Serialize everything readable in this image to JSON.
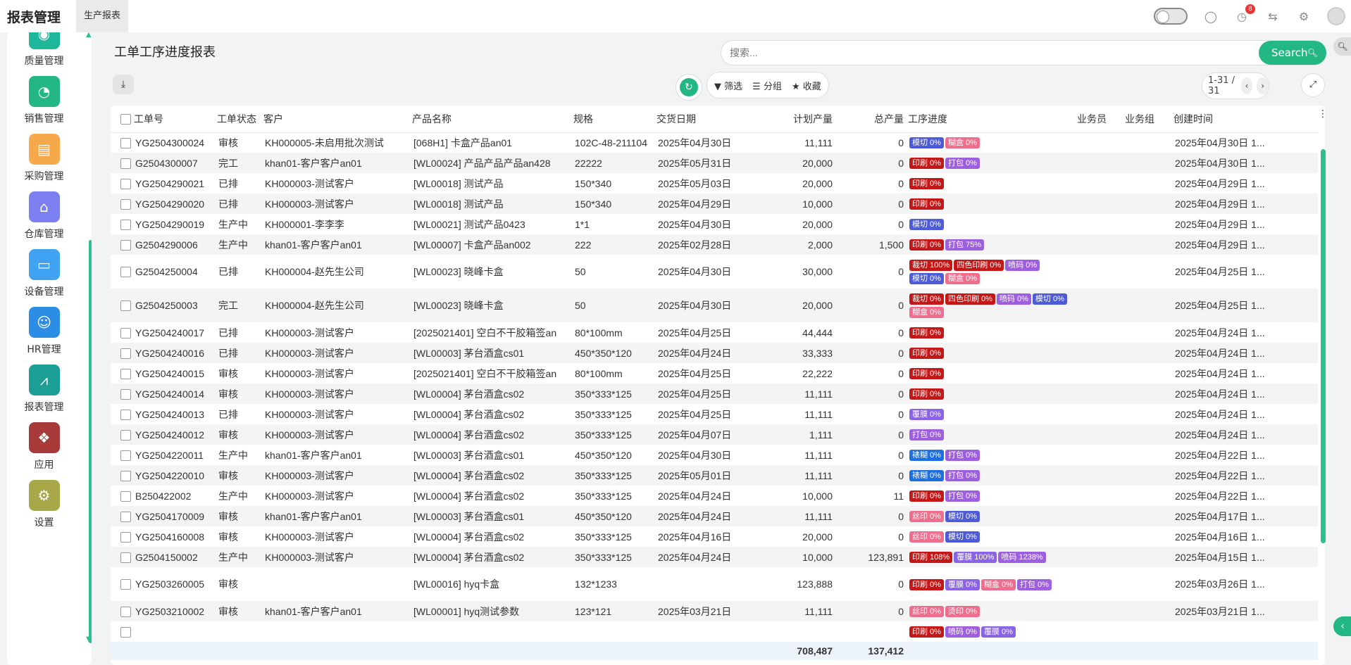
{
  "app_title": "报表管理",
  "top_tab": "生产报表",
  "notification_count": "8",
  "sidebar": {
    "items": [
      {
        "label": "质量管理",
        "icon": "quality-icon",
        "color": "#1fb79a"
      },
      {
        "label": "销售管理",
        "icon": "pie-chart-icon",
        "color": "#23b883"
      },
      {
        "label": "采购管理",
        "icon": "purchase-icon",
        "color": "#f6a94a"
      },
      {
        "label": "仓库管理",
        "icon": "warehouse-icon",
        "color": "#7b7ff0"
      },
      {
        "label": "设备管理",
        "icon": "device-icon",
        "color": "#3fa3f2"
      },
      {
        "label": "HR管理",
        "icon": "hr-icon",
        "color": "#2b8de3"
      },
      {
        "label": "报表管理",
        "icon": "report-icon",
        "color": "#1a9e96"
      },
      {
        "label": "应用",
        "icon": "apps-icon",
        "color": "#a83a3a"
      },
      {
        "label": "设置",
        "icon": "settings-icon",
        "color": "#a8a848"
      }
    ]
  },
  "page": {
    "title": "工单工序进度报表",
    "search_placeholder": "搜索...",
    "search_label": "Search",
    "filter_label": "筛选",
    "group_label": "分组",
    "favorite_label": "收藏",
    "pager": "1-31 / 31"
  },
  "table": {
    "headers": [
      "工单号",
      "工单状态",
      "客户",
      "产品名称",
      "规格",
      "交货日期",
      "计划产量",
      "总产量",
      "工序进度",
      "业务员",
      "业务组",
      "创建时间"
    ],
    "rows": [
      {
        "no": "YG2504300024",
        "status": "审核",
        "customer": "KH000005-未启用批次测试",
        "product": "[068H1] 卡盒产品an01",
        "spec": "102C-48-211104",
        "date": "2025年04月30日",
        "plan": "11,111",
        "total": "0",
        "progress": [
          {
            "t": "模切 0%",
            "c": "#4e5bd6"
          },
          {
            "t": "糊盒 0%",
            "c": "#ef6e8e"
          }
        ],
        "created": "2025年04月30日 1..."
      },
      {
        "no": "G2504300007",
        "status": "完工",
        "customer": "khan01-客户客户an01",
        "product": "[WL00024] 产品产品产品an428",
        "spec": "22222",
        "date": "2025年05月31日",
        "plan": "20,000",
        "total": "0",
        "progress": [
          {
            "t": "印刷 0%",
            "c": "#c41818"
          },
          {
            "t": "打包 0%",
            "c": "#9d5fe0"
          }
        ],
        "created": "2025年04月30日 1..."
      },
      {
        "no": "YG2504290021",
        "status": "已排",
        "customer": "KH000003-测试客户",
        "product": "[WL00018] 测试产品",
        "spec": "150*340",
        "date": "2025年05月03日",
        "plan": "20,000",
        "total": "0",
        "progress": [
          {
            "t": "印刷 0%",
            "c": "#c41818"
          }
        ],
        "created": "2025年04月29日 1..."
      },
      {
        "no": "YG2504290020",
        "status": "已排",
        "customer": "KH000003-测试客户",
        "product": "[WL00018] 测试产品",
        "spec": "150*340",
        "date": "2025年04月29日",
        "plan": "10,000",
        "total": "0",
        "progress": [
          {
            "t": "印刷 0%",
            "c": "#c41818"
          }
        ],
        "created": "2025年04月29日 1..."
      },
      {
        "no": "YG2504290019",
        "status": "生产中",
        "customer": "KH000001-李李李",
        "product": "[WL00021] 测试产品0423",
        "spec": "1*1",
        "date": "2025年04月30日",
        "plan": "20,000",
        "total": "0",
        "progress": [
          {
            "t": "模切 0%",
            "c": "#4e5bd6"
          }
        ],
        "created": "2025年04月29日 1..."
      },
      {
        "no": "G2504290006",
        "status": "生产中",
        "customer": "khan01-客户客户an01",
        "product": "[WL00007] 卡盒产品an002",
        "spec": "222",
        "date": "2025年02月28日",
        "plan": "2,000",
        "total": "1,500",
        "progress": [
          {
            "t": "印刷 0%",
            "c": "#c41818"
          },
          {
            "t": "打包 75%",
            "c": "#9d5fe0"
          }
        ],
        "created": "2025年04月29日 1..."
      },
      {
        "no": "G2504250004",
        "status": "已排",
        "customer": "KH000004-赵先生公司",
        "product": "[WL00023] 晓峰卡盒",
        "spec": "50",
        "date": "2025年04月30日",
        "plan": "30,000",
        "total": "0",
        "progress": [
          {
            "t": "裁切 100%",
            "c": "#c41818"
          },
          {
            "t": "四色印刷 0%",
            "c": "#c41818"
          },
          {
            "t": "喷码 0%",
            "c": "#9d5fe0"
          },
          {
            "t": "模切 0%",
            "c": "#4e5bd6"
          },
          {
            "t": "糊盒 0%",
            "c": "#ef6e8e"
          }
        ],
        "created": "2025年04月25日 1..."
      },
      {
        "no": "G2504250003",
        "status": "完工",
        "customer": "KH000004-赵先生公司",
        "product": "[WL00023] 晓峰卡盒",
        "spec": "50",
        "date": "2025年04月30日",
        "plan": "20,000",
        "total": "0",
        "progress": [
          {
            "t": "裁切 0%",
            "c": "#c41818"
          },
          {
            "t": "四色印刷 0%",
            "c": "#c41818"
          },
          {
            "t": "喷码 0%",
            "c": "#9d5fe0"
          },
          {
            "t": "模切 0%",
            "c": "#4e5bd6"
          },
          {
            "t": "糊盒 0%",
            "c": "#ef6e8e"
          }
        ],
        "created": "2025年04月25日 1..."
      },
      {
        "no": "YG2504240017",
        "status": "已排",
        "customer": "KH000003-测试客户",
        "product": "[2025021401] 空白不干胶箱签an",
        "spec": "80*100mm",
        "date": "2025年04月25日",
        "plan": "44,444",
        "total": "0",
        "progress": [
          {
            "t": "印刷 0%",
            "c": "#c41818"
          }
        ],
        "created": "2025年04月24日 1..."
      },
      {
        "no": "YG2504240016",
        "status": "已排",
        "customer": "KH000003-测试客户",
        "product": "[WL00003] 茅台酒盒cs01",
        "spec": "450*350*120",
        "date": "2025年04月24日",
        "plan": "33,333",
        "total": "0",
        "progress": [
          {
            "t": "印刷 0%",
            "c": "#c41818"
          }
        ],
        "created": "2025年04月24日 1..."
      },
      {
        "no": "YG2504240015",
        "status": "审核",
        "customer": "KH000003-测试客户",
        "product": "[2025021401] 空白不干胶箱签an",
        "spec": "80*100mm",
        "date": "2025年04月25日",
        "plan": "22,222",
        "total": "0",
        "progress": [
          {
            "t": "印刷 0%",
            "c": "#c41818"
          }
        ],
        "created": "2025年04月24日 1..."
      },
      {
        "no": "YG2504240014",
        "status": "审核",
        "customer": "KH000003-测试客户",
        "product": "[WL00004] 茅台酒盒cs02",
        "spec": "350*333*125",
        "date": "2025年04月25日",
        "plan": "11,111",
        "total": "0",
        "progress": [
          {
            "t": "印刷 0%",
            "c": "#c41818"
          }
        ],
        "created": "2025年04月24日 1..."
      },
      {
        "no": "YG2504240013",
        "status": "已排",
        "customer": "KH000003-测试客户",
        "product": "[WL00004] 茅台酒盒cs02",
        "spec": "350*333*125",
        "date": "2025年04月25日",
        "plan": "11,111",
        "total": "0",
        "progress": [
          {
            "t": "覆膜 0%",
            "c": "#8a63e6"
          }
        ],
        "created": "2025年04月24日 1..."
      },
      {
        "no": "YG2504240012",
        "status": "审核",
        "customer": "KH000003-测试客户",
        "product": "[WL00004] 茅台酒盒cs02",
        "spec": "350*333*125",
        "date": "2025年04月07日",
        "plan": "1,111",
        "total": "0",
        "progress": [
          {
            "t": "打包 0%",
            "c": "#9d5fe0"
          }
        ],
        "created": "2025年04月24日 1..."
      },
      {
        "no": "YG2504220011",
        "status": "生产中",
        "customer": "khan01-客户客户an01",
        "product": "[WL00003] 茅台酒盒cs01",
        "spec": "450*350*120",
        "date": "2025年04月30日",
        "plan": "11,111",
        "total": "0",
        "progress": [
          {
            "t": "裱糊 0%",
            "c": "#1d6fe0"
          },
          {
            "t": "打包 0%",
            "c": "#9d5fe0"
          }
        ],
        "created": "2025年04月22日 1..."
      },
      {
        "no": "YG2504220010",
        "status": "审核",
        "customer": "KH000003-测试客户",
        "product": "[WL00004] 茅台酒盒cs02",
        "spec": "350*333*125",
        "date": "2025年05月01日",
        "plan": "11,111",
        "total": "0",
        "progress": [
          {
            "t": "裱糊 0%",
            "c": "#1d6fe0"
          },
          {
            "t": "打包 0%",
            "c": "#9d5fe0"
          }
        ],
        "created": "2025年04月22日 1..."
      },
      {
        "no": "B250422002",
        "status": "生产中",
        "customer": "KH000003-测试客户",
        "product": "[WL00004] 茅台酒盒cs02",
        "spec": "350*333*125",
        "date": "2025年04月24日",
        "plan": "10,000",
        "total": "11",
        "progress": [
          {
            "t": "印刷 0%",
            "c": "#c41818"
          },
          {
            "t": "打包 0%",
            "c": "#9d5fe0"
          }
        ],
        "created": "2025年04月22日 1..."
      },
      {
        "no": "YG2504170009",
        "status": "审核",
        "customer": "khan01-客户客户an01",
        "product": "[WL00003] 茅台酒盒cs01",
        "spec": "450*350*120",
        "date": "2025年04月24日",
        "plan": "11,111",
        "total": "0",
        "progress": [
          {
            "t": "丝印 0%",
            "c": "#ef6e8e"
          },
          {
            "t": "模切 0%",
            "c": "#4e5bd6"
          }
        ],
        "created": "2025年04月17日 1..."
      },
      {
        "no": "YG2504160008",
        "status": "审核",
        "customer": "KH000003-测试客户",
        "product": "[WL00004] 茅台酒盒cs02",
        "spec": "350*333*125",
        "date": "2025年04月16日",
        "plan": "20,000",
        "total": "0",
        "progress": [
          {
            "t": "丝印 0%",
            "c": "#ef6e8e"
          },
          {
            "t": "模切 0%",
            "c": "#4e5bd6"
          }
        ],
        "created": "2025年04月16日 1..."
      },
      {
        "no": "G2504150002",
        "status": "生产中",
        "customer": "KH000003-测试客户",
        "product": "[WL00004] 茅台酒盒cs02",
        "spec": "350*333*125",
        "date": "2025年04月24日",
        "plan": "10,000",
        "total": "123,891",
        "progress": [
          {
            "t": "印刷 108%",
            "c": "#c41818"
          },
          {
            "t": "覆膜 100%",
            "c": "#8a63e6"
          },
          {
            "t": "喷码 1238%",
            "c": "#9d5fe0"
          }
        ],
        "created": "2025年04月15日 1..."
      },
      {
        "no": "YG2503260005",
        "status": "审核",
        "customer": "",
        "product": "[WL00016] hyq卡盒",
        "spec": "132*1233",
        "date": "",
        "plan": "123,888",
        "total": "0",
        "progress": [
          {
            "t": "印刷 0%",
            "c": "#c41818"
          },
          {
            "t": "覆膜 0%",
            "c": "#8a63e6"
          },
          {
            "t": "糊盒 0%",
            "c": "#ef6e8e"
          },
          {
            "t": "打包 0%",
            "c": "#9d5fe0"
          }
        ],
        "created": "2025年03月26日 1..."
      },
      {
        "no": "YG2503210002",
        "status": "审核",
        "customer": "khan01-客户客户an01",
        "product": "[WL00001] hyq测试参数",
        "spec": "123*121",
        "date": "2025年03月21日",
        "plan": "11,111",
        "total": "0",
        "progress": [
          {
            "t": "丝印 0%",
            "c": "#ef6e8e"
          },
          {
            "t": "烫印 0%",
            "c": "#ef6e8e"
          }
        ],
        "created": "2025年03月21日 1..."
      },
      {
        "no": "",
        "status": "",
        "customer": "",
        "product": "",
        "spec": "",
        "date": "",
        "plan": "",
        "total": "",
        "progress": [
          {
            "t": "印刷 0%",
            "c": "#c41818"
          },
          {
            "t": "喷码 0%",
            "c": "#9d5fe0"
          },
          {
            "t": "覆膜 0%",
            "c": "#8a63e6"
          }
        ],
        "created": ""
      }
    ],
    "totals": {
      "plan": "708,487",
      "total": "137,412"
    }
  }
}
